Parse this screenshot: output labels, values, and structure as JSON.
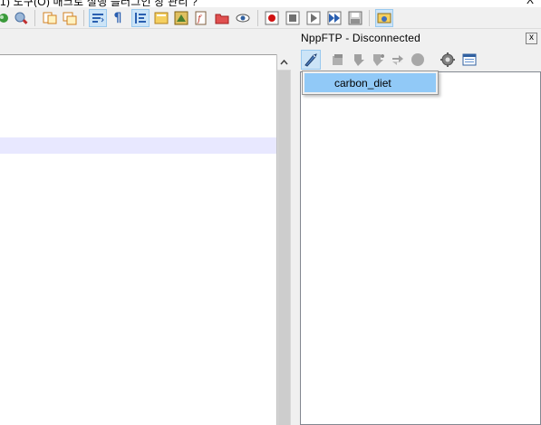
{
  "menubar": {
    "text": "1)   도구(O)   매크로   실행   플러그인   창 관리   ?",
    "close": "X"
  },
  "ftp": {
    "title": "NppFTP - Disconnected",
    "close": "x",
    "profiles": [
      "carbon_diet"
    ]
  },
  "colors": {
    "current_line": "#e8e8ff",
    "menu_highlight": "#91c9f7",
    "toolbar_active": "#cce4f7"
  }
}
